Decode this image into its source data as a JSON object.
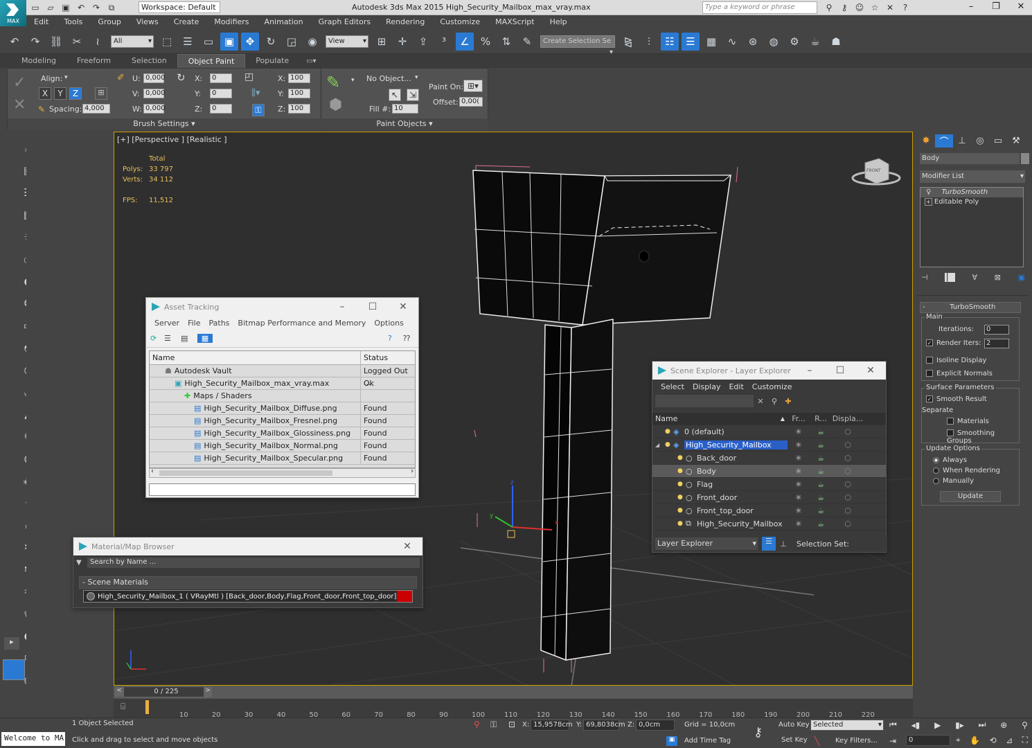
{
  "app": {
    "logo_text": "MAX",
    "workspace": "Workspace: Default",
    "title": "Autodesk 3ds Max  2015     High_Security_Mailbox_max_vray.max",
    "search_placeholder": "Type a keyword or phrase"
  },
  "menu": [
    "Edit",
    "Tools",
    "Group",
    "Views",
    "Create",
    "Modifiers",
    "Animation",
    "Graph Editors",
    "Rendering",
    "Customize",
    "MAXScript",
    "Help"
  ],
  "toolbar": {
    "filter": "All",
    "coord": "View",
    "selection_set": "Create Selection Se"
  },
  "ribbon": {
    "tabs": [
      "Modeling",
      "Freeform",
      "Selection",
      "Object Paint",
      "Populate"
    ],
    "active_tab": "Object Paint",
    "align_label": "Align:",
    "axes": [
      "X",
      "Y",
      "Z"
    ],
    "spacing_label": "Spacing:",
    "spacing_value": "4,000",
    "u_label": "U:",
    "u_value": "0,000",
    "v_label": "V:",
    "v_value": "0,000",
    "w_label": "W:",
    "w_value": "0,000",
    "rx_label": "X:",
    "rx_value": "0",
    "ry_label": "Y:",
    "ry_value": "0",
    "rz_label": "Z:",
    "rz_value": "0",
    "sx_label": "X:",
    "sx_value": "100",
    "sy_label": "Y:",
    "sy_value": "100",
    "sz_label": "Z:",
    "sz_value": "100",
    "brush_settings": "Brush Settings",
    "no_object": "No Object...",
    "fill_label": "Fill #:",
    "fill_value": "10",
    "paint_on_label": "Paint On:",
    "offset_label": "Offset:",
    "offset_value": "0,00(",
    "paint_objects": "Paint Objects"
  },
  "viewport": {
    "label": "[+] [Perspective ] [Realistic ]",
    "total_label": "Total",
    "polys_label": "Polys:",
    "polys_value": "33 797",
    "verts_label": "Verts:",
    "verts_value": "34 112",
    "fps_label": "FPS:",
    "fps_value": "11,512",
    "viewcube_label": "FRONT"
  },
  "asset_tracking": {
    "title": "Asset Tracking",
    "menu": [
      "Server",
      "File",
      "Paths",
      "Bitmap Performance and Memory",
      "Options"
    ],
    "col_name": "Name",
    "col_status": "Status",
    "rows": [
      {
        "name": "Autodesk Vault",
        "status": "Logged Out ...",
        "indent": 1
      },
      {
        "name": "High_Security_Mailbox_max_vray.max",
        "status": "Ok",
        "indent": 2
      },
      {
        "name": "Maps / Shaders",
        "status": "",
        "indent": 3
      },
      {
        "name": "High_Security_Mailbox_Diffuse.png",
        "status": "Found",
        "indent": 4
      },
      {
        "name": "High_Security_Mailbox_Fresnel.png",
        "status": "Found",
        "indent": 4
      },
      {
        "name": "High_Security_Mailbox_Glossiness.png",
        "status": "Found",
        "indent": 4
      },
      {
        "name": "High_Security_Mailbox_Normal.png",
        "status": "Found",
        "indent": 4
      },
      {
        "name": "High_Security_Mailbox_Specular.png",
        "status": "Found",
        "indent": 4
      }
    ]
  },
  "material_browser": {
    "title": "Material/Map Browser",
    "search_placeholder": "Search by Name ...",
    "section": "- Scene Materials",
    "item": "High_Security_Mailbox_1  ( VRayMtl ) [Back_door,Body,Flag,Front_door,Front_top_door]"
  },
  "scene_explorer": {
    "title": "Scene Explorer - Layer Explorer",
    "menu": [
      "Select",
      "Display",
      "Edit",
      "Customize"
    ],
    "cols": [
      "Name",
      "Fr...",
      "R...",
      "Displa..."
    ],
    "rows": [
      {
        "name": "0 (default)",
        "type": "layer",
        "selected": false,
        "level": 0
      },
      {
        "name": "High_Security_Mailbox",
        "type": "layer",
        "selected": true,
        "level": 0
      },
      {
        "name": "Back_door",
        "type": "object",
        "selected": false,
        "level": 1
      },
      {
        "name": "Body",
        "type": "object",
        "selected": false,
        "highlight": true,
        "level": 1
      },
      {
        "name": "Flag",
        "type": "object",
        "selected": false,
        "level": 1
      },
      {
        "name": "Front_door",
        "type": "object",
        "selected": false,
        "level": 1
      },
      {
        "name": "Front_top_door",
        "type": "object",
        "selected": false,
        "level": 1
      },
      {
        "name": "High_Security_Mailbox",
        "type": "group",
        "selected": false,
        "level": 1
      }
    ],
    "footer_mode": "Layer Explorer",
    "selection_set_label": "Selection Set:"
  },
  "command_panel": {
    "object_name": "Body",
    "modifier_list": "Modifier List",
    "stack": [
      "TurboSmooth",
      "Editable Poly"
    ],
    "rollout_title": "TurboSmooth",
    "main_label": "Main",
    "iterations_label": "Iterations:",
    "iterations_value": "0",
    "render_iters_label": "Render Iters:",
    "render_iters_value": "2",
    "isoline": "Isoline Display",
    "explicit_normals": "Explicit Normals",
    "surface_params": "Surface Parameters",
    "smooth_result": "Smooth Result",
    "separate": "Separate",
    "materials": "Materials",
    "smoothing_groups": "Smoothing Groups",
    "update_options": "Update Options",
    "always": "Always",
    "when_rendering": "When Rendering",
    "manually": "Manually",
    "update_btn": "Update"
  },
  "timeline": {
    "frame": "0 / 225",
    "ticks": [
      "0",
      "10",
      "20",
      "30",
      "40",
      "50",
      "60",
      "70",
      "80",
      "90",
      "100",
      "110",
      "120",
      "130",
      "140",
      "150",
      "160",
      "170",
      "180",
      "190",
      "200",
      "210",
      "220"
    ]
  },
  "status": {
    "welcome": "Welcome to MA",
    "selected_text": "1 Object Selected",
    "prompt": "Click and drag to select and move objects",
    "x_label": "X:",
    "x_value": "15,9578cm",
    "y_label": "Y:",
    "y_value": "69,8038cm",
    "z_label": "Z:",
    "z_value": "0,0cm",
    "grid": "Grid = 10,0cm",
    "add_time_tag": "Add Time Tag",
    "auto_key": "Auto Key",
    "set_key": "Set Key",
    "key_mode": "Selected",
    "key_filters": "Key Filters...",
    "frame_value": "0"
  }
}
